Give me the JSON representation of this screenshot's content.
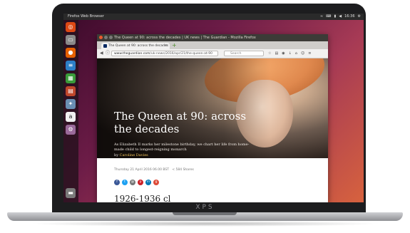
{
  "laptop": {
    "brand": "XPS"
  },
  "panel": {
    "title": "Firefox Web Browser",
    "time": "16:36"
  },
  "launcher": {
    "icons": [
      "ubuntu-icon",
      "files-icon",
      "firefox-icon",
      "writer-icon",
      "calc-icon",
      "impress-icon",
      "software-center-icon",
      "amazon-icon",
      "settings-icon",
      "trash-icon"
    ]
  },
  "browser": {
    "window_title": "The Queen at 90: across the decades | UK news | The Guardian - Mozilla Firefox",
    "tab_label": "The Queen at 90: across the decades",
    "url_domain": "www.theguardian.com",
    "url_path": "/uk-news/2016/apr/21/the-queen-at-90",
    "search_placeholder": "Search"
  },
  "article": {
    "headline": "The Queen at 90: across the decades",
    "standfirst": "As Elizabeth II marks her milestone birthday, we chart her life from home-made child to longest-reigning monarch",
    "byline_prefix": "by",
    "byline_author": "Caroline Davies",
    "meta": "Thursday 21 April 2016 06.00 BST",
    "shares": "< 584 Shares",
    "share_icons": [
      "facebook",
      "twitter",
      "email",
      "pinterest",
      "linkedin",
      "googleplus"
    ],
    "year_heading": "1926-1936 cl"
  },
  "colors": {
    "accent": "#e9592e",
    "guardian_blue": "#052962",
    "byline_yellow": "#f6c75a"
  }
}
